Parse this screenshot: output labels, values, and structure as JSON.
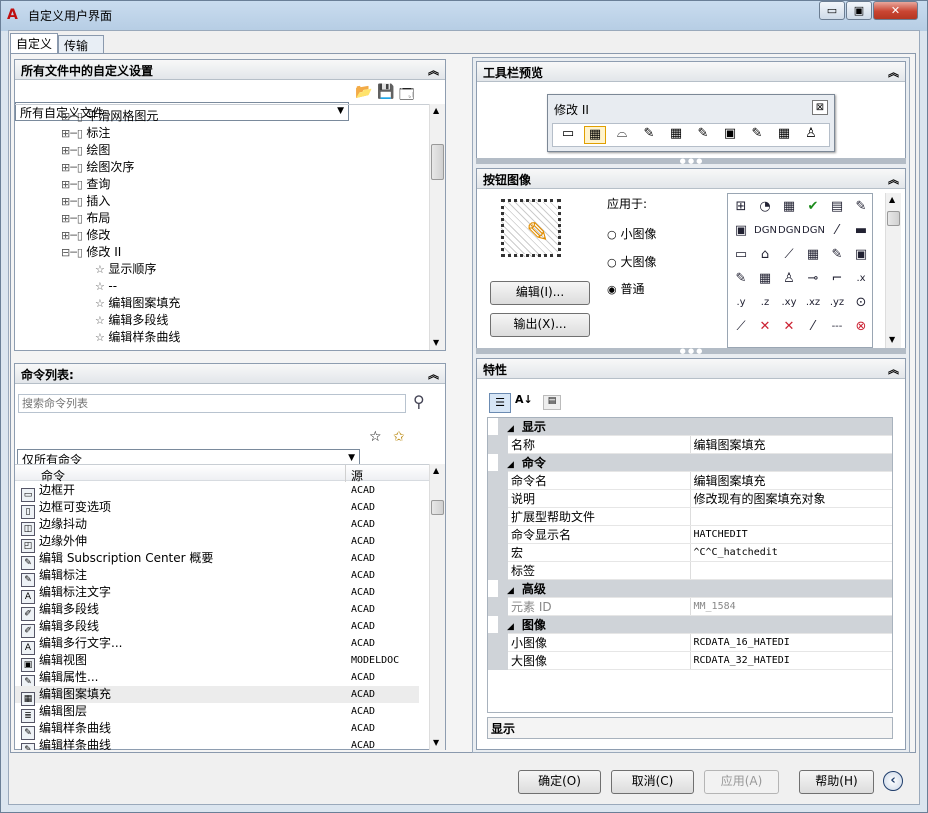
{
  "window": {
    "title": "自定义用户界面",
    "min": "▭",
    "max": "▣",
    "close": "✕"
  },
  "tabs": [
    "自定义",
    "传输"
  ],
  "left": {
    "settings_title": "所有文件中的自定义设置",
    "file_select": "所有自定义文件",
    "tree": [
      "平滑网格图元",
      "标注",
      "绘图",
      "绘图次序",
      "查询",
      "插入",
      "布局",
      "修改",
      "修改 II",
      "显示顺序",
      "--",
      "编辑图案填充",
      "编辑多段线",
      "编辑样条曲线"
    ],
    "cmd_title": "命令列表:",
    "search_placeholder": "搜索命令列表",
    "filter_select": "仅所有命令",
    "col_cmd": "命令",
    "col_src": "源",
    "commands": [
      {
        "name": "边框开",
        "src": "ACAD"
      },
      {
        "name": "边框可变选项",
        "src": "ACAD"
      },
      {
        "name": "边缘抖动",
        "src": "ACAD"
      },
      {
        "name": "边缘外伸",
        "src": "ACAD"
      },
      {
        "name": "编辑 Subscription Center 概要",
        "src": "ACAD"
      },
      {
        "name": "编辑标注",
        "src": "ACAD"
      },
      {
        "name": "编辑标注文字",
        "src": "ACAD"
      },
      {
        "name": "编辑多段线",
        "src": "ACAD"
      },
      {
        "name": "编辑多段线",
        "src": "ACAD"
      },
      {
        "name": "编辑多行文字...",
        "src": "ACAD"
      },
      {
        "name": "编辑视图",
        "src": "MODELDOC"
      },
      {
        "name": "编辑属性...",
        "src": "ACAD"
      },
      {
        "name": "编辑图案填充",
        "src": "ACAD"
      },
      {
        "name": "编辑图层",
        "src": "ACAD"
      },
      {
        "name": "编辑样条曲线",
        "src": "ACAD"
      },
      {
        "name": "编辑样条曲线",
        "src": "ACAD"
      }
    ]
  },
  "right": {
    "toolbar_preview_title": "工具栏预览",
    "toolbar_name": "修改 II",
    "toolbar_close": "⊠",
    "button_image_title": "按钮图像",
    "apply_to": "应用于:",
    "radio": [
      "小图像",
      "大图像",
      "普通"
    ],
    "edit_btn": "编辑(I)...",
    "export_btn": "输出(X)...",
    "image_tiles": [
      "⊞",
      "◔",
      "▦",
      "✔",
      "▤",
      "✎",
      "▣",
      "DGN",
      "DGN",
      "DGN",
      "⁄",
      "▬",
      "▭",
      "⌂",
      "⟋",
      "▦",
      "✎",
      "▣",
      "✎",
      "▦",
      "♙",
      "⊸",
      "⌐",
      ".x",
      ".y",
      ".z",
      ".xy",
      ".xz",
      ".yz",
      "⊙",
      "⟋",
      "✕",
      "✕",
      "⁄",
      "---",
      "⊗"
    ],
    "props_title": "特性",
    "props": [
      {
        "cat": "显示"
      },
      {
        "k": "名称",
        "v": "编辑图案填充"
      },
      {
        "cat": "命令"
      },
      {
        "k": "命令名",
        "v": "编辑图案填充"
      },
      {
        "k": "说明",
        "v": "修改现有的图案填充对象"
      },
      {
        "k": "扩展型帮助文件",
        "v": ""
      },
      {
        "k": "命令显示名",
        "v": "HATCHEDIT"
      },
      {
        "k": "宏",
        "v": "^C^C_hatchedit"
      },
      {
        "k": "标签",
        "v": ""
      },
      {
        "cat": "高级"
      },
      {
        "k": "元素 ID",
        "v": "MM_1584",
        "grey": true
      },
      {
        "cat": "图像"
      },
      {
        "k": "小图像",
        "v": "RCDATA_16_HATEDI"
      },
      {
        "k": "大图像",
        "v": "RCDATA_32_HATEDI"
      }
    ],
    "desc_label": "显示"
  },
  "footer": {
    "ok": "确定(O)",
    "cancel": "取消(C)",
    "apply": "应用(A)",
    "help": "帮助(H)"
  }
}
